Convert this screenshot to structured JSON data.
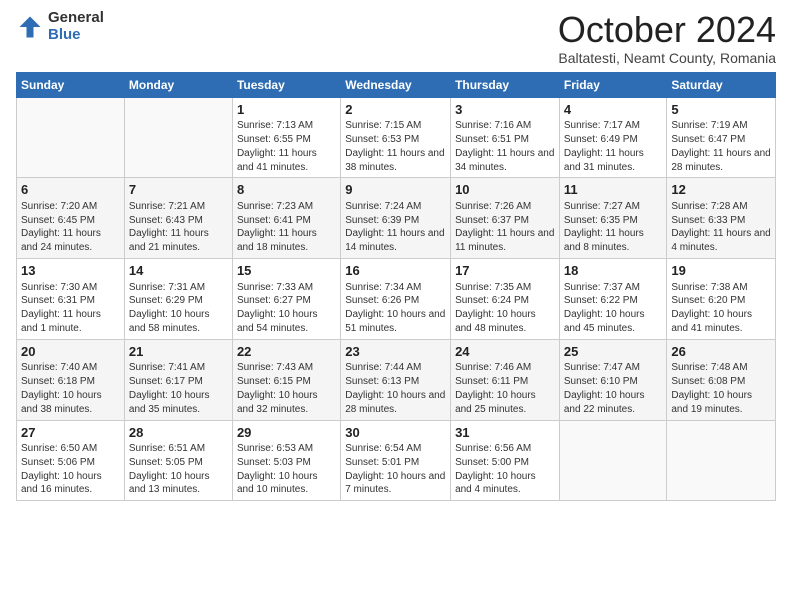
{
  "logo": {
    "general": "General",
    "blue": "Blue"
  },
  "header": {
    "month": "October 2024",
    "location": "Baltatesti, Neamt County, Romania"
  },
  "days_of_week": [
    "Sunday",
    "Monday",
    "Tuesday",
    "Wednesday",
    "Thursday",
    "Friday",
    "Saturday"
  ],
  "weeks": [
    [
      {
        "day": "",
        "info": ""
      },
      {
        "day": "",
        "info": ""
      },
      {
        "day": "1",
        "info": "Sunrise: 7:13 AM\nSunset: 6:55 PM\nDaylight: 11 hours and 41 minutes."
      },
      {
        "day": "2",
        "info": "Sunrise: 7:15 AM\nSunset: 6:53 PM\nDaylight: 11 hours and 38 minutes."
      },
      {
        "day": "3",
        "info": "Sunrise: 7:16 AM\nSunset: 6:51 PM\nDaylight: 11 hours and 34 minutes."
      },
      {
        "day": "4",
        "info": "Sunrise: 7:17 AM\nSunset: 6:49 PM\nDaylight: 11 hours and 31 minutes."
      },
      {
        "day": "5",
        "info": "Sunrise: 7:19 AM\nSunset: 6:47 PM\nDaylight: 11 hours and 28 minutes."
      }
    ],
    [
      {
        "day": "6",
        "info": "Sunrise: 7:20 AM\nSunset: 6:45 PM\nDaylight: 11 hours and 24 minutes."
      },
      {
        "day": "7",
        "info": "Sunrise: 7:21 AM\nSunset: 6:43 PM\nDaylight: 11 hours and 21 minutes."
      },
      {
        "day": "8",
        "info": "Sunrise: 7:23 AM\nSunset: 6:41 PM\nDaylight: 11 hours and 18 minutes."
      },
      {
        "day": "9",
        "info": "Sunrise: 7:24 AM\nSunset: 6:39 PM\nDaylight: 11 hours and 14 minutes."
      },
      {
        "day": "10",
        "info": "Sunrise: 7:26 AM\nSunset: 6:37 PM\nDaylight: 11 hours and 11 minutes."
      },
      {
        "day": "11",
        "info": "Sunrise: 7:27 AM\nSunset: 6:35 PM\nDaylight: 11 hours and 8 minutes."
      },
      {
        "day": "12",
        "info": "Sunrise: 7:28 AM\nSunset: 6:33 PM\nDaylight: 11 hours and 4 minutes."
      }
    ],
    [
      {
        "day": "13",
        "info": "Sunrise: 7:30 AM\nSunset: 6:31 PM\nDaylight: 11 hours and 1 minute."
      },
      {
        "day": "14",
        "info": "Sunrise: 7:31 AM\nSunset: 6:29 PM\nDaylight: 10 hours and 58 minutes."
      },
      {
        "day": "15",
        "info": "Sunrise: 7:33 AM\nSunset: 6:27 PM\nDaylight: 10 hours and 54 minutes."
      },
      {
        "day": "16",
        "info": "Sunrise: 7:34 AM\nSunset: 6:26 PM\nDaylight: 10 hours and 51 minutes."
      },
      {
        "day": "17",
        "info": "Sunrise: 7:35 AM\nSunset: 6:24 PM\nDaylight: 10 hours and 48 minutes."
      },
      {
        "day": "18",
        "info": "Sunrise: 7:37 AM\nSunset: 6:22 PM\nDaylight: 10 hours and 45 minutes."
      },
      {
        "day": "19",
        "info": "Sunrise: 7:38 AM\nSunset: 6:20 PM\nDaylight: 10 hours and 41 minutes."
      }
    ],
    [
      {
        "day": "20",
        "info": "Sunrise: 7:40 AM\nSunset: 6:18 PM\nDaylight: 10 hours and 38 minutes."
      },
      {
        "day": "21",
        "info": "Sunrise: 7:41 AM\nSunset: 6:17 PM\nDaylight: 10 hours and 35 minutes."
      },
      {
        "day": "22",
        "info": "Sunrise: 7:43 AM\nSunset: 6:15 PM\nDaylight: 10 hours and 32 minutes."
      },
      {
        "day": "23",
        "info": "Sunrise: 7:44 AM\nSunset: 6:13 PM\nDaylight: 10 hours and 28 minutes."
      },
      {
        "day": "24",
        "info": "Sunrise: 7:46 AM\nSunset: 6:11 PM\nDaylight: 10 hours and 25 minutes."
      },
      {
        "day": "25",
        "info": "Sunrise: 7:47 AM\nSunset: 6:10 PM\nDaylight: 10 hours and 22 minutes."
      },
      {
        "day": "26",
        "info": "Sunrise: 7:48 AM\nSunset: 6:08 PM\nDaylight: 10 hours and 19 minutes."
      }
    ],
    [
      {
        "day": "27",
        "info": "Sunrise: 6:50 AM\nSunset: 5:06 PM\nDaylight: 10 hours and 16 minutes."
      },
      {
        "day": "28",
        "info": "Sunrise: 6:51 AM\nSunset: 5:05 PM\nDaylight: 10 hours and 13 minutes."
      },
      {
        "day": "29",
        "info": "Sunrise: 6:53 AM\nSunset: 5:03 PM\nDaylight: 10 hours and 10 minutes."
      },
      {
        "day": "30",
        "info": "Sunrise: 6:54 AM\nSunset: 5:01 PM\nDaylight: 10 hours and 7 minutes."
      },
      {
        "day": "31",
        "info": "Sunrise: 6:56 AM\nSunset: 5:00 PM\nDaylight: 10 hours and 4 minutes."
      },
      {
        "day": "",
        "info": ""
      },
      {
        "day": "",
        "info": ""
      }
    ]
  ]
}
